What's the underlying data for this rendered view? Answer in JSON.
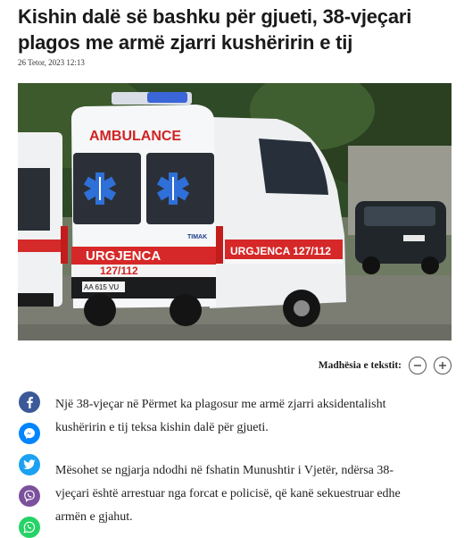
{
  "article": {
    "title": "Kishin dalë së bashku për gjueti, 38-vjeçari plagos me armë zjarri kushëririn e tij",
    "date": "26 Tetor, 2023 12:13"
  },
  "photo": {
    "ambulance_front_label": "AMBULANCE",
    "side_label": "URGJENCA",
    "phone": "127/112",
    "side_label_with_phone": "URGJENCA 127/112",
    "plate": "AA 615 VU",
    "brand": "TIMAK"
  },
  "text_size": {
    "label": "Madhësia e tekstit:"
  },
  "share": {
    "icons": [
      "facebook-icon",
      "messenger-icon",
      "twitter-icon",
      "viber-icon",
      "whatsapp-icon"
    ],
    "colors": {
      "facebook": "#3b5998",
      "messenger": "#0084ff",
      "twitter": "#1da1f2",
      "viber": "#7b519d",
      "whatsapp": "#25d366"
    }
  },
  "body": {
    "paragraphs": [
      "Një 38-vjeçar në Përmet ka plagosur me armë zjarri aksidentalisht kushëririn e tij teksa kishin dalë për gjueti.",
      "Mësohet se ngjarja ndodhi në fshatin Munushtir i Vjetër, ndërsa 38-vjeçari është arrestuar nga forcat e policisë, që kanë sekuestruar edhe armën e gjahut."
    ]
  }
}
